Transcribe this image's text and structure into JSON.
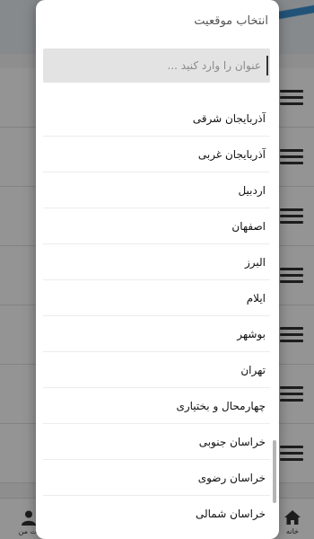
{
  "dialog": {
    "title": "انتخاب موقعیت",
    "search": {
      "placeholder": "عنوان را وارد کنید ...",
      "value": ""
    },
    "items": [
      "آذربایجان شرقی",
      "آذربایجان غربی",
      "اردبیل",
      "اصفهان",
      "البرز",
      "ایلام",
      "بوشهر",
      "تهران",
      "چهارمحال و بختیاری",
      "خراسان جنوبی",
      "خراسان رضوی",
      "خراسان شمالی"
    ]
  },
  "background": {
    "nav": {
      "home_label": "خانه",
      "mine_label": "ات من"
    }
  },
  "icons": {
    "menu": "menu-lines-icon",
    "user": "user-icon",
    "home": "home-icon"
  },
  "colors": {
    "accent": "#3a8fd0",
    "search_bg": "#e3e3e3",
    "text": "#111111",
    "overlay": "rgba(0,0,0,0.42)"
  }
}
